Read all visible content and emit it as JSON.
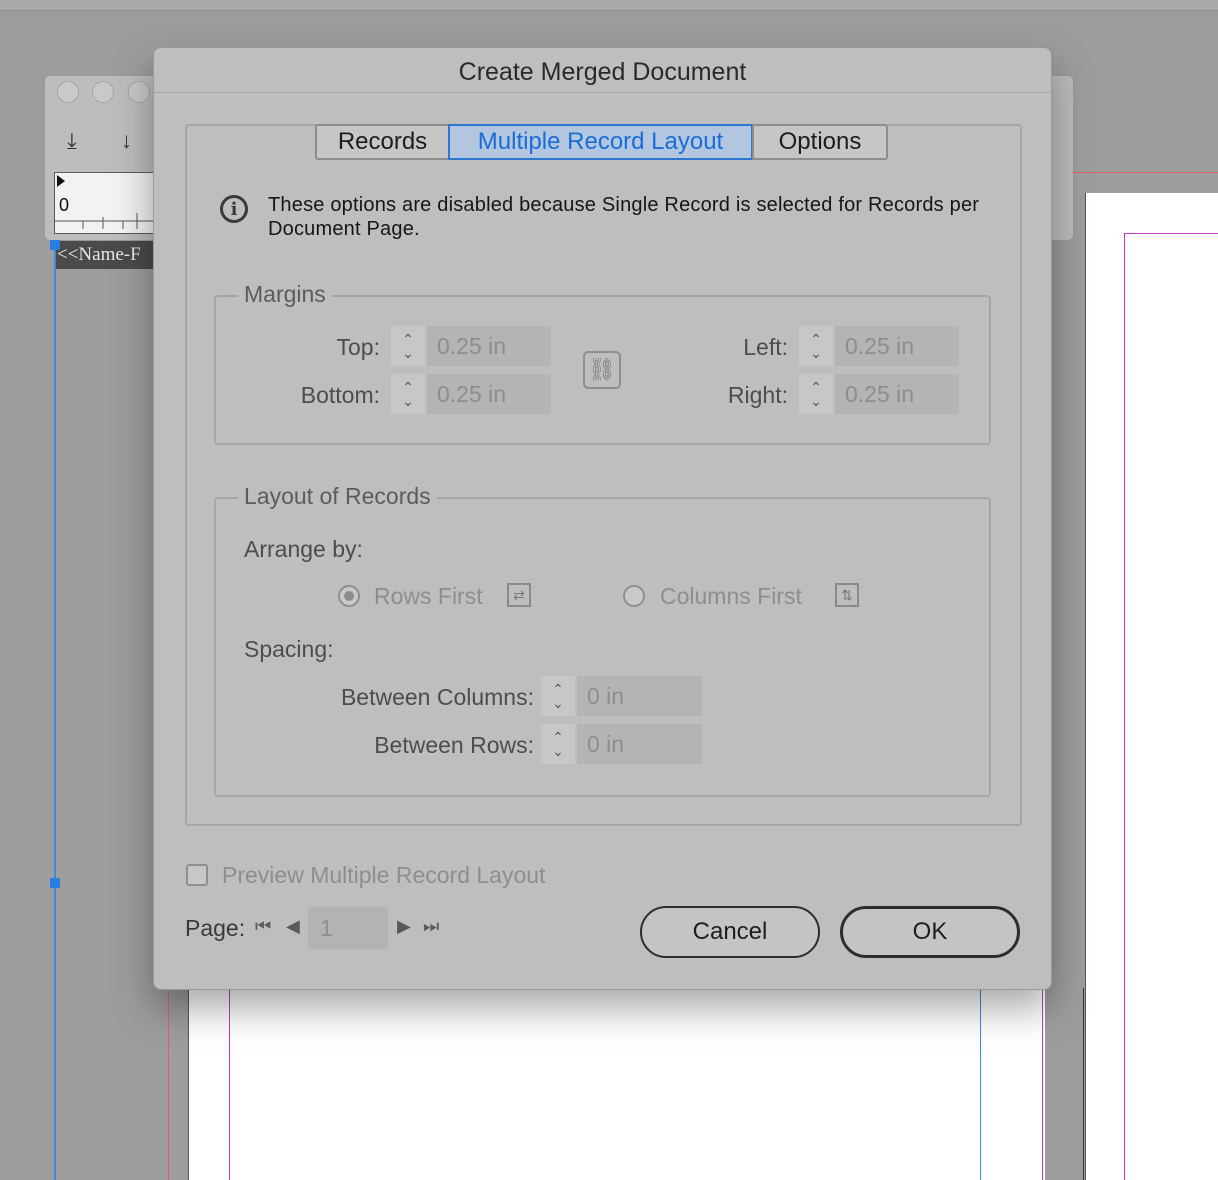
{
  "background": {
    "ruler_zero": "0",
    "text_frame_content": "<<Name-F"
  },
  "dialog": {
    "title": "Create Merged Document",
    "tabs": [
      {
        "label": "Records",
        "active": false
      },
      {
        "label": "Multiple Record Layout",
        "active": true
      },
      {
        "label": "Options",
        "active": false
      }
    ],
    "info_message": "These options are disabled because Single Record is selected for Records per Document Page.",
    "margins": {
      "legend": "Margins",
      "top_label": "Top:",
      "top_value": "0.25 in",
      "bottom_label": "Bottom:",
      "bottom_value": "0.25 in",
      "left_label": "Left:",
      "left_value": "0.25 in",
      "right_label": "Right:",
      "right_value": "0.25 in",
      "link_icon": "chain-link-icon"
    },
    "layout": {
      "legend": "Layout of Records",
      "arrange_by_label": "Arrange by:",
      "rows_first": "Rows First",
      "columns_first": "Columns First",
      "selected": "Rows First",
      "spacing_label": "Spacing:",
      "between_columns_label": "Between Columns:",
      "between_columns_value": "0 in",
      "between_rows_label": "Between Rows:",
      "between_rows_value": "0 in"
    },
    "preview_checkbox": {
      "label": "Preview Multiple Record Layout",
      "checked": false
    },
    "page_nav": {
      "label": "Page:",
      "value": "1"
    },
    "buttons": {
      "cancel": "Cancel",
      "ok": "OK"
    }
  },
  "colors": {
    "accent": "#1a6cd8",
    "dialog_bg": "#bebebe",
    "disabled_text": "#8e8e8e"
  }
}
